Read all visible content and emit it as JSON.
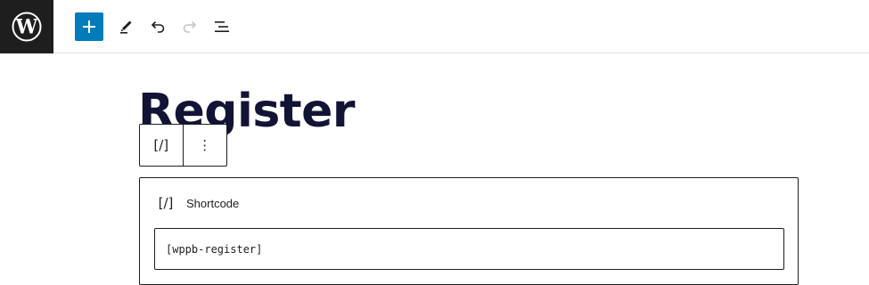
{
  "toolbar": {
    "logo_icon": "wordpress-logo-icon",
    "add_block_icon": "plus-icon",
    "tools_icon": "pencil-icon",
    "undo_icon": "undo-icon",
    "redo_icon": "redo-icon",
    "list_view_icon": "list-view-icon",
    "accent_color": "#007cba"
  },
  "post": {
    "title": "Register"
  },
  "block_toolbar": {
    "block_type_glyph": "[/]",
    "block_type_icon": "shortcode-icon",
    "options_glyph": "⋮",
    "options_icon": "more-vertical-icon"
  },
  "shortcode_block": {
    "icon_glyph": "[/]",
    "label": "Shortcode",
    "value": "[wppb-register]"
  }
}
